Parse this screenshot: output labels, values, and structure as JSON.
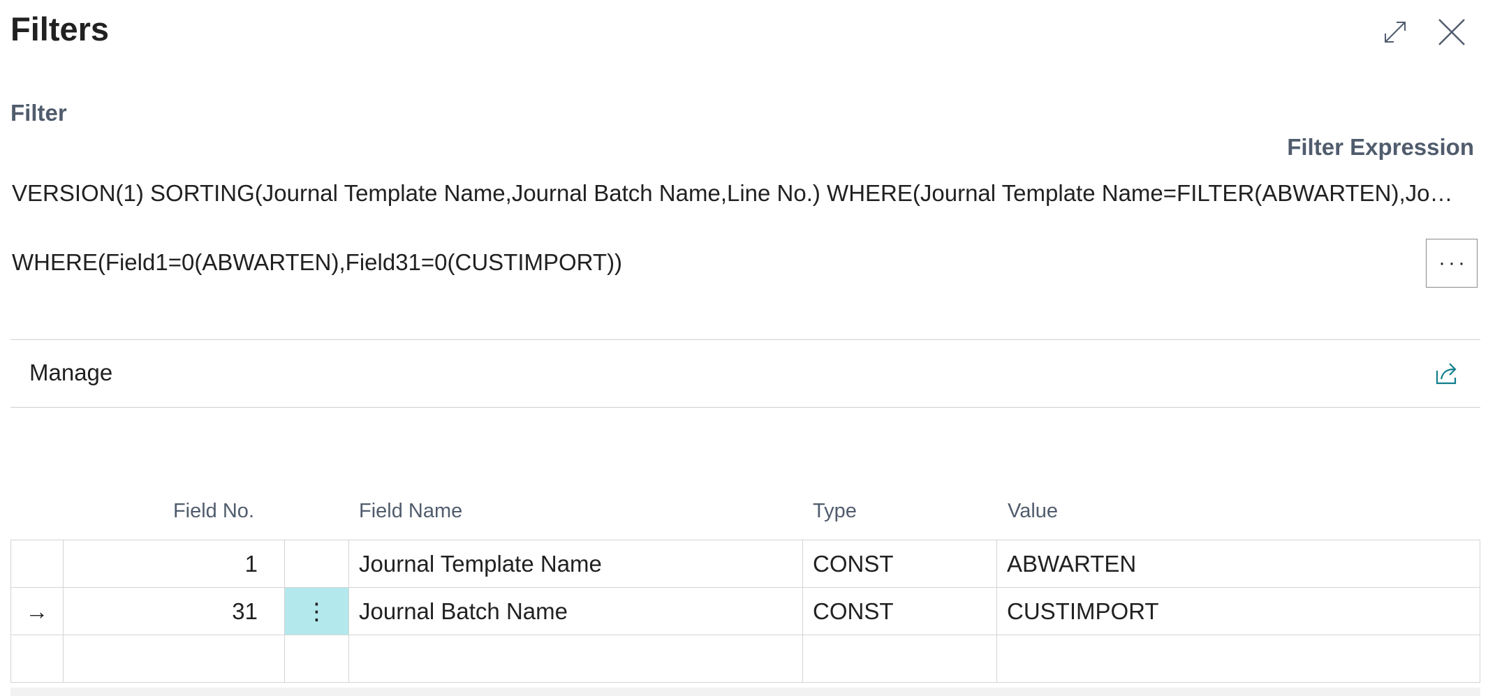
{
  "dialog": {
    "title": "Filters",
    "expand_icon": "expand-diagonal-icon",
    "close_icon": "close-icon"
  },
  "filter": {
    "section_label": "Filter",
    "expression_label": "Filter Expression",
    "expression_text": "VERSION(1) SORTING(Journal Template Name,Journal Batch Name,Line No.) WHERE(Journal Template Name=FILTER(ABWARTEN),Jo…",
    "where_text": "WHERE(Field1=0(ABWARTEN),Field31=0(CUSTIMPORT))",
    "more_button_label": "···"
  },
  "manage": {
    "label": "Manage",
    "share_icon": "share-icon"
  },
  "table": {
    "headers": {
      "field_no": "Field No.",
      "field_name": "Field Name",
      "type": "Type",
      "value": "Value"
    },
    "rows": [
      {
        "indicator": "",
        "field_no": "1",
        "menu": "",
        "field_name": "Journal Template Name",
        "type": "CONST",
        "value": "ABWARTEN"
      },
      {
        "indicator": "→",
        "field_no": "31",
        "menu": "⋮",
        "field_name": "Journal Batch Name",
        "type": "CONST",
        "value": "CUSTIMPORT"
      },
      {
        "indicator": "",
        "field_no": "",
        "menu": "",
        "field_name": "",
        "type": "",
        "value": ""
      }
    ]
  },
  "colors": {
    "selected_cell": "#b3e8ec",
    "accent": "#0f7d8c",
    "label_gray": "#505c6d"
  }
}
